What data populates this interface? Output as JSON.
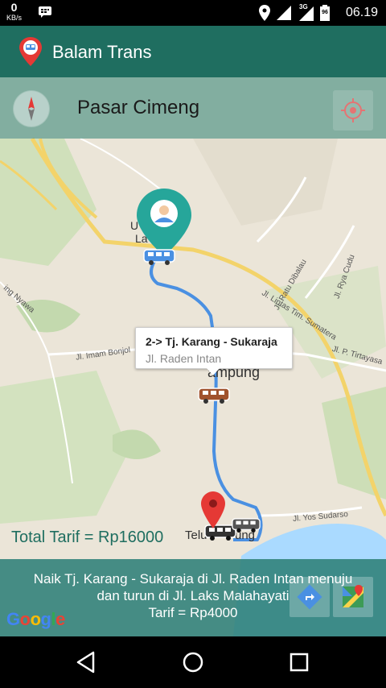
{
  "status_bar": {
    "net_speed_value": "0",
    "net_speed_unit": "KB/s",
    "battery_level": "96",
    "network_type": "3G",
    "time": "06.19"
  },
  "app_bar": {
    "title": "Balam Trans"
  },
  "search": {
    "place": "Pasar Cimeng"
  },
  "map": {
    "labels": {
      "univ_top": "U",
      "univ_bottom": "La",
      "ratu_dibalau": "Jl. Ratu Dibalau",
      "lintas_sumatera": "Jl. Lintas Tim. Sumatera",
      "raya_cudu": "Jl. Rya Cudu",
      "imam_bonjol": "Jl. Imam Bonjol",
      "tirtayasa": "Jl. P. Tirtayasa",
      "nyawa": "ing Nyawa",
      "lampung": "ampung",
      "yos_sudarso": "Jl. Yos Sudarso",
      "telukbetung": "Telu",
      "telukbetung_end": "ung"
    },
    "callout": {
      "title": "2-> Tj. Karang - Sukaraja",
      "subtitle": "Jl. Raden Intan"
    },
    "total_tarif": "Total Tarif = Rp16000",
    "google": [
      "G",
      "o",
      "o",
      "g",
      "l",
      "e"
    ]
  },
  "info_panel": {
    "line1": "Naik Tj. Karang - Sukaraja di Jl. Raden Intan menuju",
    "line2": "dan turun di Jl. Laks Malahayati",
    "line3": "Tarif = Rp4000"
  },
  "colors": {
    "app_bar": "#1f6e60",
    "route": "#4a90e2",
    "marker_teal": "#26a69a",
    "marker_red": "#e53935"
  }
}
